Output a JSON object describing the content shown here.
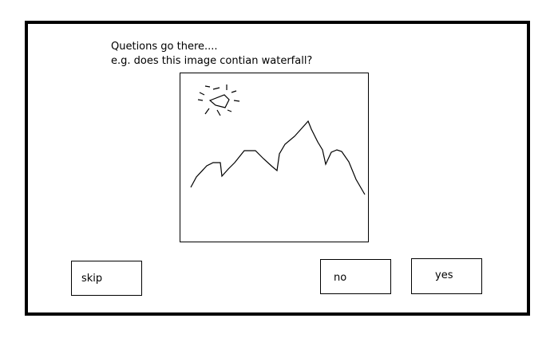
{
  "question": {
    "line1": "Quetions go there....",
    "line2": "e.g. does this image contian waterfall?"
  },
  "image": {
    "icon": "mountain-sun-sketch-icon"
  },
  "buttons": {
    "skip_label": "skip",
    "no_label": "no",
    "yes_label": "yes"
  },
  "colors": {
    "border": "#000000",
    "background": "#ffffff"
  }
}
